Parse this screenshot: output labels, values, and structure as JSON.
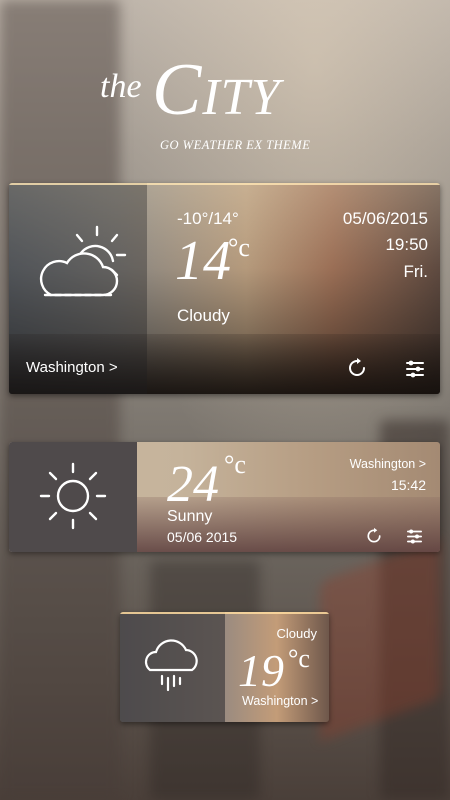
{
  "logo": {
    "the": "the",
    "city": "City",
    "subtitle": "GO WEATHER EX THEME"
  },
  "widget_large": {
    "temp_range": "-10°/14°",
    "temperature": "14",
    "unit": "°c",
    "condition": "Cloudy",
    "date": "05/06/2015",
    "time": "19:50",
    "day": "Fri.",
    "location": "Washington >",
    "icon": "partly-cloudy-icon"
  },
  "widget_medium": {
    "temperature": "24",
    "unit": "°c",
    "condition": "Sunny",
    "date": "05/06 2015",
    "location": "Washington >",
    "time": "15:42",
    "icon": "sun-icon"
  },
  "widget_small": {
    "condition": "Cloudy",
    "temperature": "19",
    "unit": "°c",
    "location": "Washington >",
    "icon": "rain-cloud-icon"
  }
}
